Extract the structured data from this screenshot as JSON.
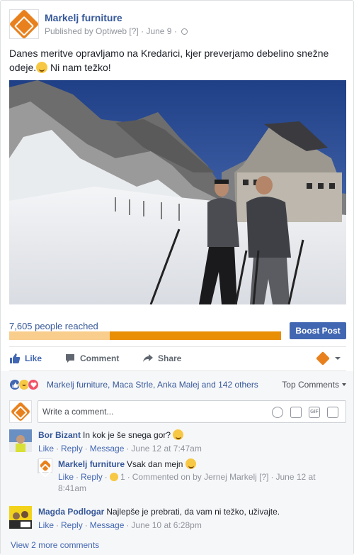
{
  "post": {
    "page_name": "Markelj furniture",
    "published_by": "Published by Optiweb",
    "info_marker": "[?]",
    "date": "June 9",
    "message_part1": "Danes meritve opravljamo na Kredarici, kjer preverjamo debelino snežne odeje.",
    "message_part2": " Ni nam težko!"
  },
  "reach": {
    "label": "7,605 people reached",
    "organic_fraction": 0.37,
    "boost_label": "Boost Post"
  },
  "actions": {
    "like": "Like",
    "comment": "Comment",
    "share": "Share"
  },
  "reactions": {
    "icons": [
      "like",
      "haha",
      "love"
    ],
    "summary": "Markelj furniture, Maca Strle, Anka Malej and 142 others",
    "sort_label": "Top Comments"
  },
  "composer": {
    "placeholder": "Write a comment..."
  },
  "comments": [
    {
      "author": "Bor Bizant",
      "text": "In kok je še snega gor?",
      "like": "Like",
      "reply": "Reply",
      "message": "Message",
      "time": "June 12 at 7:47am"
    },
    {
      "author": "Markelj furniture",
      "text": "Vsak dan mejn",
      "like": "Like",
      "reply": "Reply",
      "reaction_count": "1",
      "commented_on": "Commented on by Jernej Markelj",
      "info_marker": "[?]",
      "time_line1": "June 12 at",
      "time_line2": "8:41am"
    },
    {
      "author": "Magda Podlogar",
      "text": "Najlepše je prebrati, da vam ni težko, uživajte.",
      "like": "Like",
      "reply": "Reply",
      "message": "Message",
      "time": "June 10 at 6:28pm"
    }
  ],
  "view_more": "View 2 more comments",
  "colors": {
    "link_blue": "#365899",
    "button_blue": "#4267b2",
    "brand_orange": "#e8811d",
    "bar_orange": "#e98f05"
  }
}
